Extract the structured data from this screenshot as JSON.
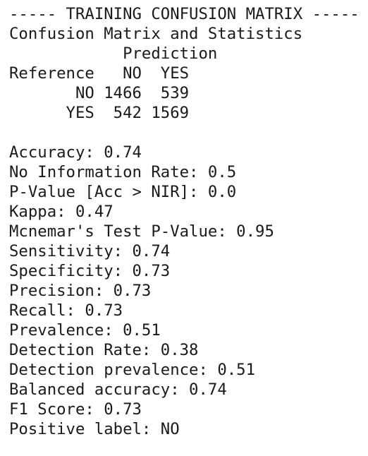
{
  "output": {
    "header": "----- TRAINING CONFUSION MATRIX -----",
    "subtitle": "Confusion Matrix and Statistics",
    "matrix": {
      "prediction_label": "            Prediction",
      "header_row": "Reference   NO  YES",
      "row_no": "       NO 1466  539",
      "row_yes": "      YES  542 1569"
    },
    "stats": [
      "Accuracy: 0.74",
      "No Information Rate: 0.5",
      "P-Value [Acc > NIR]: 0.0",
      "Kappa: 0.47",
      "Mcnemar's Test P-Value: 0.95",
      "Sensitivity: 0.74",
      "Specificity: 0.73",
      "Precision: 0.73",
      "Recall: 0.73",
      "Prevalence: 0.51",
      "Detection Rate: 0.38",
      "Detection prevalence: 0.51",
      "Balanced accuracy: 0.74",
      "F1 Score: 0.73",
      "Positive label: NO"
    ]
  }
}
